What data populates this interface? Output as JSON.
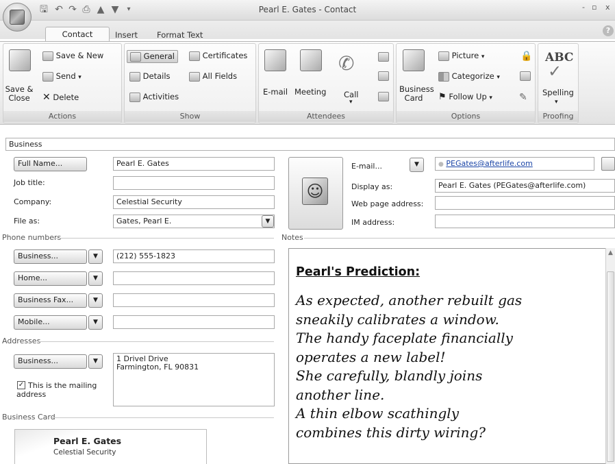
{
  "window": {
    "title": "Pearl E. Gates - Contact",
    "controls": [
      "-",
      "▫",
      "x"
    ]
  },
  "tabs": [
    {
      "label": "Contact",
      "active": true
    },
    {
      "label": "Insert",
      "active": false
    },
    {
      "label": "Format Text",
      "active": false
    }
  ],
  "ribbon": {
    "actions": {
      "label": "Actions",
      "save_close": "Save &\nClose",
      "save_new": "Save & New",
      "send": "Send",
      "delete": "Delete"
    },
    "show": {
      "label": "Show",
      "general": "General",
      "details": "Details",
      "activities": "Activities",
      "certificates": "Certificates",
      "all_fields": "All Fields"
    },
    "attendees": {
      "label": "Attendees",
      "email": "E-mail",
      "meeting": "Meeting",
      "call": "Call"
    },
    "options": {
      "label": "Options",
      "business_card": "Business\nCard",
      "picture": "Picture",
      "categorize": "Categorize",
      "follow_up": "Follow Up"
    },
    "proofing": {
      "label": "Proofing",
      "spelling": "Spelling",
      "abc": "ABC"
    }
  },
  "form": {
    "category": "Business",
    "full_name_btn": "Full Name...",
    "full_name": "Pearl E. Gates",
    "job_title_label": "Job title:",
    "job_title": "",
    "company_label": "Company:",
    "company": "Celestial Security",
    "file_as_label": "File as:",
    "file_as": "Gates, Pearl E.",
    "email_btn": "E-mail...",
    "email": "PEGates@afterlife.com",
    "display_as_label": "Display as:",
    "display_as": "Pearl E. Gates (PEGates@afterlife.com)",
    "web_label": "Web page address:",
    "web": "",
    "im_label": "IM address:",
    "im": "",
    "phone_section": "Phone numbers",
    "phones": [
      {
        "type": "Business...",
        "value": "(212) 555-1823"
      },
      {
        "type": "Home...",
        "value": ""
      },
      {
        "type": "Business Fax...",
        "value": ""
      },
      {
        "type": "Mobile...",
        "value": ""
      }
    ],
    "notes_section": "Notes",
    "addresses_section": "Addresses",
    "address_type": "Business...",
    "address_line1": "1 Drivel Drive",
    "address_line2": "Farmington, FL 90831",
    "mailing_label": "This is the mailing\naddress",
    "mailing_checked": true,
    "business_card_section": "Business Card",
    "card_name": "Pearl E. Gates",
    "card_company": "Celestial Security"
  },
  "notes": {
    "heading": "Pearl's Prediction:",
    "body": "As expected, another rebuilt gas\nsneakily calibrates a window.\nThe handy faceplate financially\noperates a new label!\nShe carefully, blandly joins\nanother line.\nA thin elbow scathingly\ncombines this dirty wiring?"
  }
}
